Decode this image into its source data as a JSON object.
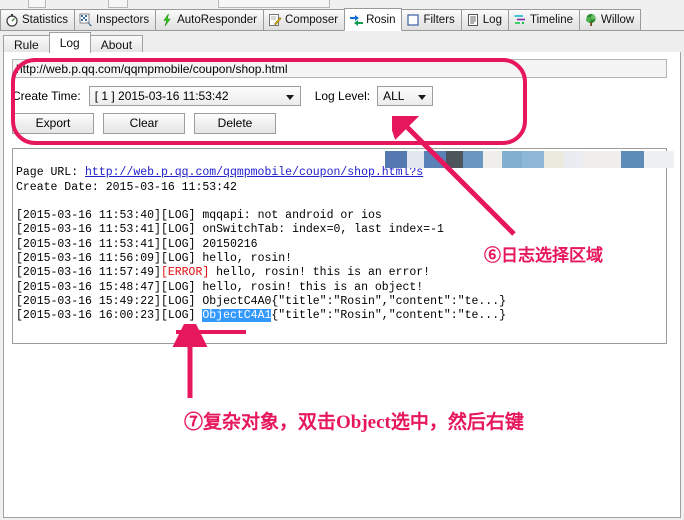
{
  "window": {
    "frame_color": "#f0f0f0"
  },
  "main_tabs": [
    {
      "label": "Statistics",
      "icon": "stopwatch-icon",
      "active": false
    },
    {
      "label": "Inspectors",
      "icon": "inspectors-icon",
      "active": false
    },
    {
      "label": "AutoResponder",
      "icon": "lightning-icon",
      "active": false
    },
    {
      "label": "Composer",
      "icon": "compose-pencil-icon",
      "active": false
    },
    {
      "label": "Rosin",
      "icon": "arrows-swap-icon",
      "active": true
    },
    {
      "label": "Filters",
      "icon": "filter-square-icon",
      "active": false
    },
    {
      "label": "Log",
      "icon": "log-list-icon",
      "active": false
    },
    {
      "label": "Timeline",
      "icon": "timeline-icon",
      "active": false
    },
    {
      "label": "Willow",
      "icon": "tree-icon",
      "active": false
    }
  ],
  "sub_tabs": [
    {
      "label": "Rule",
      "active": false
    },
    {
      "label": "Log",
      "active": true
    },
    {
      "label": "About",
      "active": false
    }
  ],
  "toolbar": {
    "url_value": "http://web.p.qq.com/qqmpmobile/coupon/shop.html",
    "url_placeholder": "",
    "create_time_label": "Create Time:",
    "create_time_value": "[ 1 ] 2015-03-16 11:53:42",
    "log_level_label": "Log Level:",
    "log_level_value": "ALL",
    "export_label": "Export",
    "clear_label": "Clear",
    "delete_label": "Delete"
  },
  "log": {
    "page_url_label": "Page URL:",
    "page_url_link": "http://web.p.qq.com/qqmpmobile/coupon/shop.html?s",
    "create_date_label": "Create Date:",
    "create_date_value": "2015-03-16 11:53:42",
    "lines": [
      {
        "time": "[2015-03-16 11:53:40]",
        "level": "[LOG]",
        "text": " mqqapi: not android or ios"
      },
      {
        "time": "[2015-03-16 11:53:41]",
        "level": "[LOG]",
        "text": " onSwitchTab: index=0, last index=-1"
      },
      {
        "time": "[2015-03-16 11:53:41]",
        "level": "[LOG]",
        "text": " 20150216"
      },
      {
        "time": "[2015-03-16 11:56:09]",
        "level": "[LOG]",
        "text": " hello, rosin!"
      },
      {
        "time": "[2015-03-16 11:57:49]",
        "level": "[ERROR]",
        "text": " hello, rosin! this is an error!"
      },
      {
        "time": "[2015-03-16 15:48:47]",
        "level": "[LOG]",
        "text": " hello, rosin! this is an object!"
      },
      {
        "time": "[2015-03-16 15:49:22]",
        "level": "[LOG]",
        "object": "ObjectC4A0",
        "text": "{\"title\":\"Rosin\",\"content\":\"te...}"
      },
      {
        "time": "[2015-03-16 16:00:23]",
        "level": "[LOG]",
        "object": "ObjectC4A1",
        "selected": true,
        "text": "{\"title\":\"Rosin\",\"content\":\"te...}"
      }
    ],
    "swatches": [
      "#5479b0",
      "#e3e8ef",
      "#5a82b8",
      "#4d545c",
      "#6997c2",
      "#efeeea",
      "#82aecf",
      "#8fb8d6",
      "#eceade",
      "#e9edf2",
      "#f0eeeb",
      "#5e8cb8",
      "#eef0f2"
    ]
  },
  "annotations": {
    "color": "#e6175c",
    "note6": "⑥日志选择区域",
    "note7": "⑦复杂对象，双击Object选中，然后右键"
  }
}
